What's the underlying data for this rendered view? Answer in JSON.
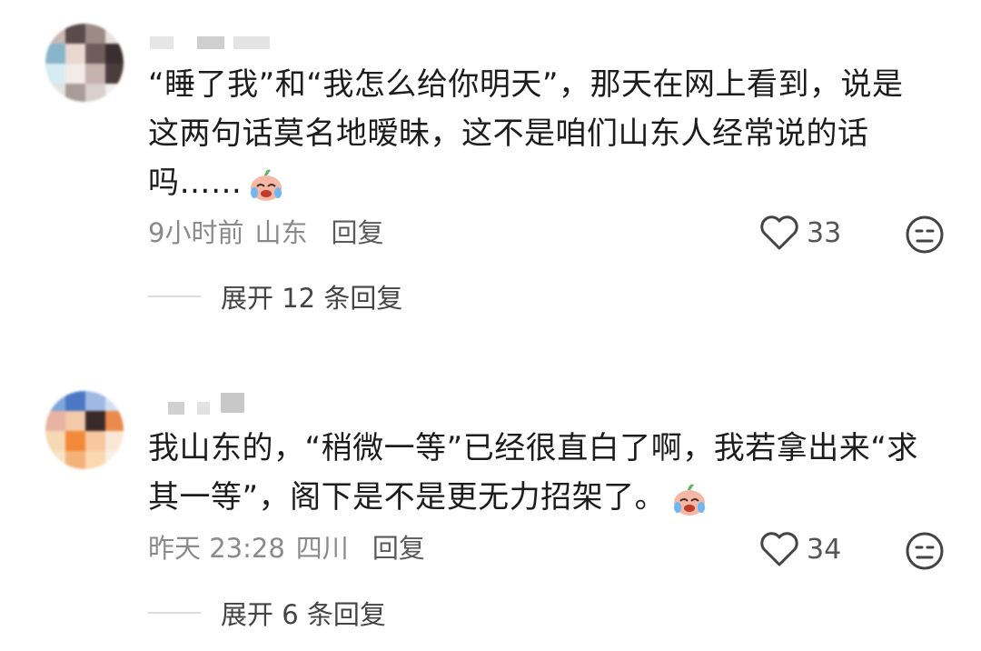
{
  "comments": [
    {
      "text_lines": [
        "“睡了我”和“我怎么给你明天”，那天在网上看到，说是",
        "这两句话莫名地暧昧，这不是咱们山东人经常说的话",
        "吗……"
      ],
      "time": "9小时前",
      "location": "山东",
      "reply_label": "回复",
      "likes": "33",
      "expand_label": "展开 12 条回复",
      "emoji": "crying-laughing-face-icon"
    },
    {
      "text_lines": [
        "我山东的，“稍微一等”已经很直白了啊，我若拿出来“求",
        "其一等”，阁下是不是更无力招架了。"
      ],
      "time": "昨天 23:28",
      "location": "四川",
      "reply_label": "回复",
      "likes": "34",
      "expand_label": "展开 6 条回复",
      "emoji": "crying-laughing-face-icon"
    }
  ]
}
